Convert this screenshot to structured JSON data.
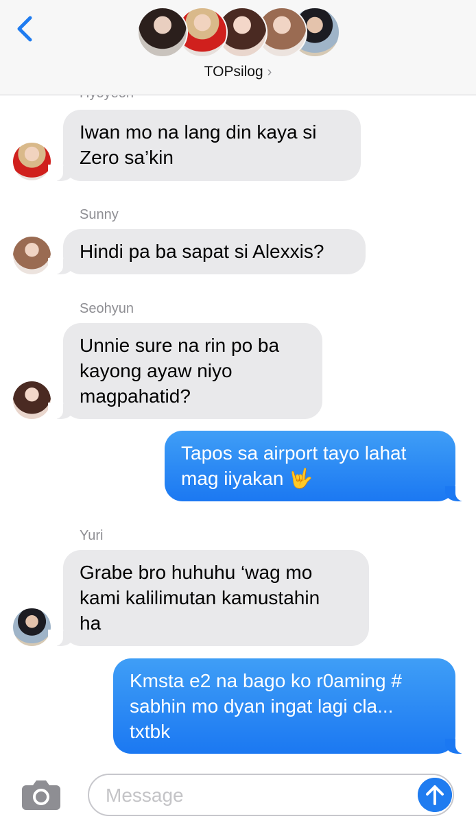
{
  "header": {
    "group_name": "TOPsilog",
    "chevron": "›",
    "back_icon": "chevron-left-icon",
    "participant_count": 5
  },
  "messages": [
    {
      "sender": "Hyoyeon",
      "text_lines": [
        "Iwan mo na lang din kaya si",
        "Zero sa’kin"
      ],
      "direction": "incoming"
    },
    {
      "sender": "Sunny",
      "text_lines": [
        "Hindi pa ba sapat si Alexxis?"
      ],
      "direction": "incoming"
    },
    {
      "sender": "Seohyun",
      "text_lines": [
        "Unnie sure na rin po ba",
        "kayong ayaw niyo",
        "magpahatid?"
      ],
      "direction": "incoming"
    },
    {
      "sender": "",
      "text_lines": [
        "Tapos sa airport tayo lahat",
        "mag iiyakan 🤟"
      ],
      "direction": "outgoing"
    },
    {
      "sender": "Yuri",
      "text_lines": [
        "Grabe bro huhuhu ‘wag mo",
        "kami kalilimutan kamustahin",
        "ha"
      ],
      "direction": "incoming"
    },
    {
      "sender": "",
      "text_lines": [
        "Kmsta e2 na bago ko r0aming #",
        "sabhin mo dyan ingat lagi cla...",
        "txtbk"
      ],
      "direction": "outgoing"
    }
  ],
  "composer": {
    "placeholder": "Message",
    "camera_icon": "camera-icon",
    "send_icon": "send-arrow-icon"
  },
  "colors": {
    "accent": "#1f7cf0",
    "incoming_bubble": "#e9e9eb",
    "outgoing_bubble": "#2a88f4",
    "secondary_text": "#8e8e93"
  }
}
